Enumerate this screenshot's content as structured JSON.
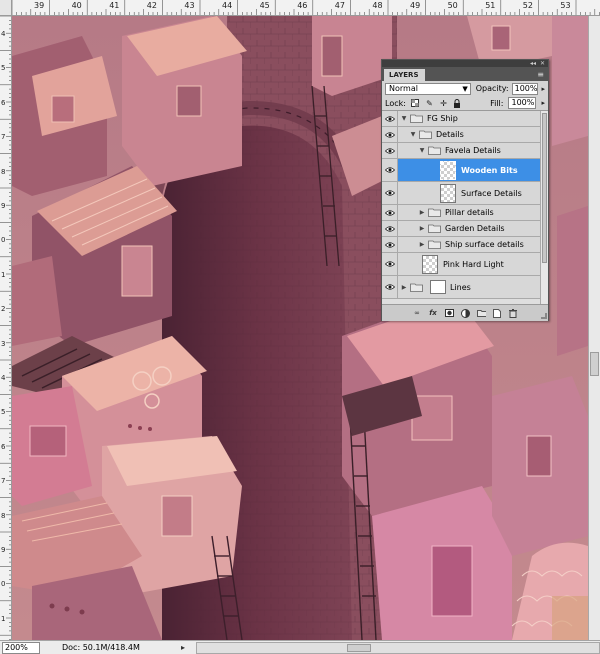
{
  "rulers": {
    "top_numbers": [
      "39",
      "40",
      "41",
      "42",
      "43",
      "44",
      "45",
      "46",
      "47",
      "48",
      "49",
      "50",
      "51",
      "52",
      "53"
    ],
    "left_numbers": [
      "4",
      "5",
      "6",
      "7",
      "8",
      "9",
      "0",
      "1",
      "2",
      "3",
      "4",
      "5",
      "6",
      "7",
      "8",
      "9",
      "0",
      "1"
    ]
  },
  "layers_panel": {
    "tab_label": "LAYERS",
    "topbar_collapse": "◂◂",
    "topbar_close": "✕",
    "menu_icon": "≡",
    "blend_mode": "Normal",
    "opacity_label": "Opacity:",
    "opacity_value": "100%",
    "lock_label": "Lock:",
    "fill_label": "Fill:",
    "fill_value": "100%",
    "layers": [
      {
        "name": "FG Ship",
        "type": "group",
        "depth": 0,
        "expanded": true,
        "selected": false
      },
      {
        "name": "Details",
        "type": "group",
        "depth": 1,
        "expanded": true,
        "selected": false
      },
      {
        "name": "Favela Details",
        "type": "group",
        "depth": 2,
        "expanded": true,
        "selected": false
      },
      {
        "name": "Wooden Bits",
        "type": "layer",
        "depth": 3,
        "selected": true
      },
      {
        "name": "Surface Details",
        "type": "layer",
        "depth": 3,
        "selected": false
      },
      {
        "name": "Pillar details",
        "type": "group",
        "depth": 2,
        "expanded": false,
        "selected": false
      },
      {
        "name": "Garden Details",
        "type": "group",
        "depth": 2,
        "expanded": false,
        "selected": false
      },
      {
        "name": "Ship surface details",
        "type": "group",
        "depth": 2,
        "expanded": false,
        "selected": false
      },
      {
        "name": "Pink Hard Light",
        "type": "layer",
        "depth": 1,
        "selected": false
      },
      {
        "name": "Lines",
        "type": "group-mask",
        "depth": 0,
        "expanded": false,
        "selected": false
      }
    ],
    "footer_icons": [
      "link-icon",
      "fx-icon",
      "mask-icon",
      "adjustment-icon",
      "folder-icon",
      "new-layer-icon",
      "trash-icon"
    ]
  },
  "status_bar": {
    "zoom": "200%",
    "doc_info": "Doc: 50.1M/418.4M",
    "arrow": "▸"
  },
  "colors": {
    "selection_blue": "#3d8fe6",
    "canvas_pink": "#b37983",
    "house_light": "#e2a39b",
    "house_dark": "#7e4057",
    "arch_dark": "#5a2c3c"
  }
}
